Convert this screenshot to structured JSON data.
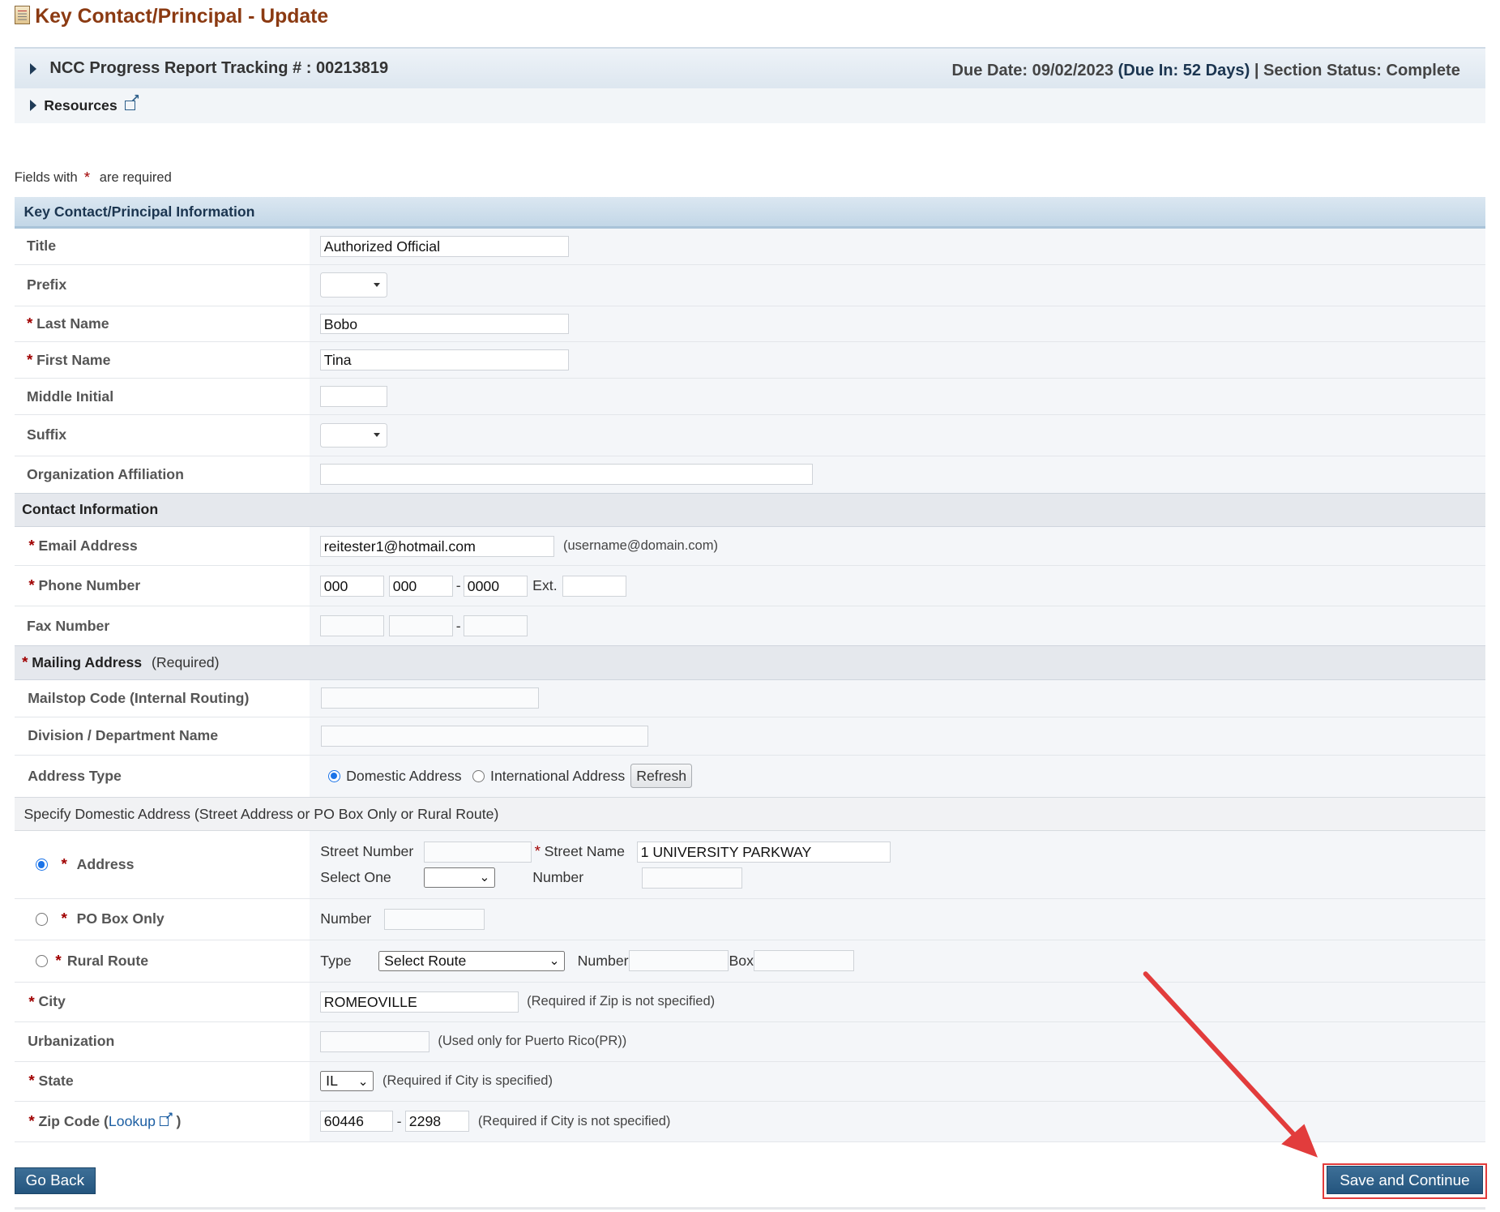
{
  "header": {
    "title": "Key Contact/Principal - Update",
    "tracking_label": "NCC Progress Report Tracking # : 00213819",
    "due_date": "Due Date: 09/02/2023",
    "due_in": "(Due In: 52 Days)",
    "separator": "|",
    "section_status": "Section Status: Complete",
    "resources_label": "Resources"
  },
  "notice": {
    "prefix": "Fields with",
    "star": "*",
    "suffix": "are required"
  },
  "key_contact": {
    "section_title": "Key Contact/Principal Information",
    "title_label": "Title",
    "title_value": "Authorized Official",
    "prefix_label": "Prefix",
    "last_name_label": "Last Name",
    "last_name_value": "Bobo",
    "first_name_label": "First Name",
    "first_name_value": "Tina",
    "middle_initial_label": "Middle Initial",
    "suffix_label": "Suffix",
    "org_affiliation_label": "Organization Affiliation"
  },
  "contact": {
    "section_title": "Contact Information",
    "email_label": "Email Address",
    "email_value": "reitester1@hotmail.com",
    "email_hint": "(username@domain.com)",
    "phone_label": "Phone Number",
    "phone_area": "000",
    "phone_prefix": "000",
    "phone_line": "0000",
    "phone_dash": "-",
    "ext_label": "Ext.",
    "fax_label": "Fax Number",
    "fax_dash": "-"
  },
  "mailing": {
    "section_title": "Mailing Address",
    "section_required": "(Required)",
    "mailstop_label": "Mailstop Code (Internal Routing)",
    "division_label": "Division / Department Name",
    "address_type_label": "Address Type",
    "domestic_label": "Domestic Address",
    "international_label": "International Address",
    "refresh_label": "Refresh",
    "specify_text": "Specify Domestic Address (Street Address or PO Box Only or Rural Route)",
    "address_label": "Address",
    "street_number_label": "Street Number",
    "street_name_label": "Street Name",
    "street_name_value": "1 UNIVERSITY PARKWAY",
    "select_one_label": "Select One",
    "number_label": "Number",
    "po_box_label": "PO Box Only",
    "po_number_label": "Number",
    "rural_route_label": "Rural Route",
    "type_label": "Type",
    "route_select_value": "Select Route",
    "rr_number_label": "Number",
    "box_label": "Box",
    "city_label": "City",
    "city_value": "ROMEOVILLE",
    "city_hint": "(Required if Zip is not specified)",
    "urbanization_label": "Urbanization",
    "urbanization_hint": "(Used only for Puerto Rico(PR))",
    "state_label": "State",
    "state_value": "IL",
    "state_hint": "(Required if City is specified)",
    "zip_label_prefix": "Zip Code (",
    "zip_lookup_label": "Lookup",
    "zip_label_suffix": ")",
    "zip_value": "60446",
    "zip_dash": "-",
    "zip_ext_value": "2298",
    "zip_hint": "(Required if City is not specified)"
  },
  "footer": {
    "go_back_label": "Go Back",
    "save_continue_label": "Save and Continue"
  },
  "colors": {
    "title": "#8b3a12",
    "required_star": "#a00000",
    "section_header": "#1b3550",
    "primary_button": "#24557e",
    "annotation_arrow": "#e23c3c"
  }
}
